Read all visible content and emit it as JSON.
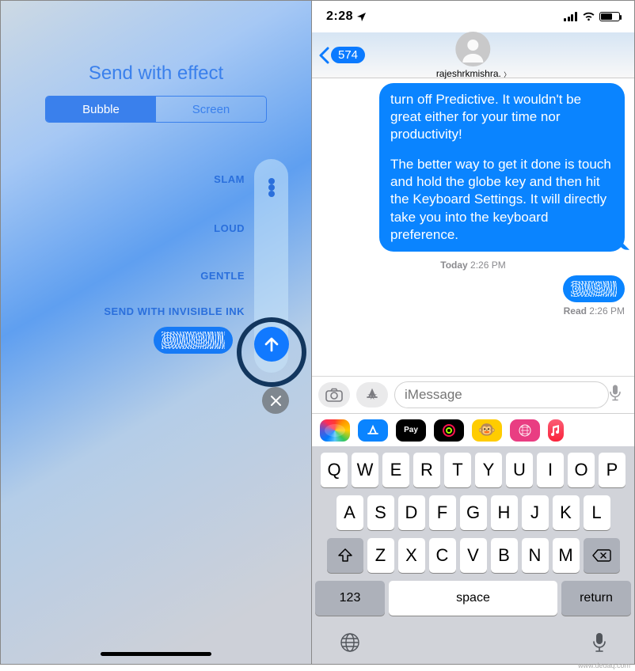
{
  "left": {
    "title": "Send with effect",
    "tabs": {
      "bubble": "Bubble",
      "screen": "Screen"
    },
    "effects": {
      "slam": "SLAM",
      "loud": "LOUD",
      "gentle": "GENTLE",
      "ink": "SEND WITH INVISIBLE INK"
    }
  },
  "right": {
    "status": {
      "time": "2:28",
      "location_arrow": "➤"
    },
    "nav": {
      "back_badge": "574",
      "contact": "rajeshrkmishra."
    },
    "messages": {
      "bubble1_line1": "turn off Predictive. It wouldn't be great either for your time nor productivity!",
      "bubble1_para2": "The better way to get it done is touch and hold the globe key and then hit the Keyboard Settings. It will directly take you into the keyboard preference.",
      "ts_day": "Today",
      "ts_time": "2:26 PM",
      "read_label": "Read",
      "read_time": "2:26 PM"
    },
    "input": {
      "placeholder": "iMessage"
    },
    "keyboard": {
      "row1": [
        "Q",
        "W",
        "E",
        "R",
        "T",
        "Y",
        "U",
        "I",
        "O",
        "P"
      ],
      "row2": [
        "A",
        "S",
        "D",
        "F",
        "G",
        "H",
        "J",
        "K",
        "L"
      ],
      "row3": [
        "Z",
        "X",
        "C",
        "V",
        "B",
        "N",
        "M"
      ],
      "k123": "123",
      "space": "space",
      "return": "return"
    }
  },
  "watermark": "www.deuaq.com"
}
